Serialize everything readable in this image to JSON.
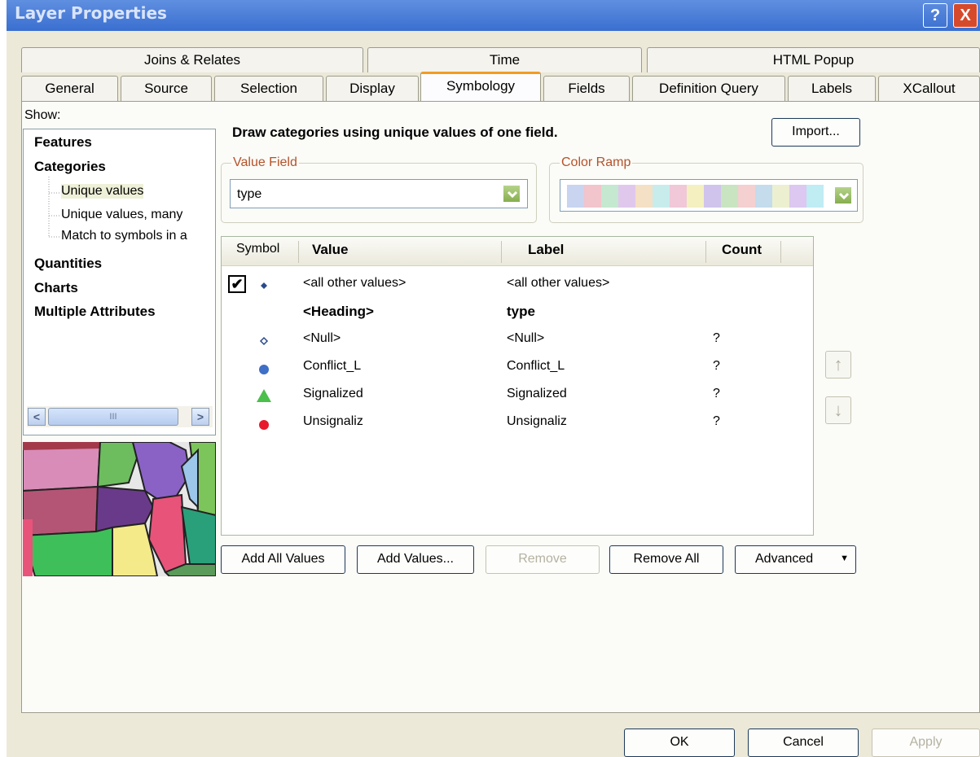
{
  "window": {
    "title": "Layer Properties",
    "help_label": "?",
    "close_label": "X"
  },
  "tabs_row1": [
    "Joins & Relates",
    "Time",
    "HTML Popup"
  ],
  "tabs_row2": [
    "General",
    "Source",
    "Selection",
    "Display",
    "Symbology",
    "Fields",
    "Definition Query",
    "Labels",
    "XCallout"
  ],
  "active_tab": "Symbology",
  "show": {
    "label": "Show:",
    "items": [
      "Features",
      "Categories",
      "Quantities",
      "Charts",
      "Multiple Attributes"
    ],
    "sub_items": [
      "Unique values",
      "Unique values, many",
      "Match to symbols in a"
    ],
    "selected": "Unique values",
    "scroll_mark": "III"
  },
  "description": "Draw categories using unique values of one field.",
  "import_label": "Import...",
  "value_field": {
    "label": "Value Field",
    "value": "type"
  },
  "color_ramp": {
    "label": "Color Ramp",
    "colors": [
      "#c8d4f0",
      "#f2c4cc",
      "#c4e8d0",
      "#e0c8ec",
      "#f4e0c4",
      "#c8ecec",
      "#f0c8d8",
      "#f4f0c0",
      "#d0c4ec",
      "#c8e4c0",
      "#f4d0d0",
      "#c4dcec",
      "#ecf0d0",
      "#dcc8f0",
      "#c0ecf4"
    ]
  },
  "columns": {
    "symbol": "Symbol",
    "value": "Value",
    "label": "Label",
    "count": "Count"
  },
  "rows": [
    {
      "symbol": "diamond-small",
      "color": "#2a4a8a",
      "checked": true,
      "value": "<all other values>",
      "label": "<all other values>",
      "count": ""
    },
    {
      "symbol": "none",
      "color": "",
      "checked": false,
      "value": "<Heading>",
      "label": "type",
      "count": "",
      "bold": true
    },
    {
      "symbol": "diamond-hollow",
      "color": "#2a4a8a",
      "checked": false,
      "value": "<Null>",
      "label": "<Null>",
      "count": "?"
    },
    {
      "symbol": "circle",
      "color": "#3f6fc6",
      "checked": false,
      "value": "Conflict_L",
      "label": "Conflict_L",
      "count": "?"
    },
    {
      "symbol": "triangle",
      "color": "#4cbf4c",
      "checked": false,
      "value": "Signalized",
      "label": "Signalized",
      "count": "?"
    },
    {
      "symbol": "circle",
      "color": "#e8192c",
      "checked": false,
      "value": "Unsignaliz",
      "label": "Unsignaliz",
      "count": "?"
    }
  ],
  "bottom_buttons": {
    "add_all": "Add All Values",
    "add": "Add Values...",
    "remove": "Remove",
    "remove_all": "Remove All",
    "advanced": "Advanced"
  },
  "dialog_buttons": {
    "ok": "OK",
    "cancel": "Cancel",
    "apply": "Apply"
  }
}
